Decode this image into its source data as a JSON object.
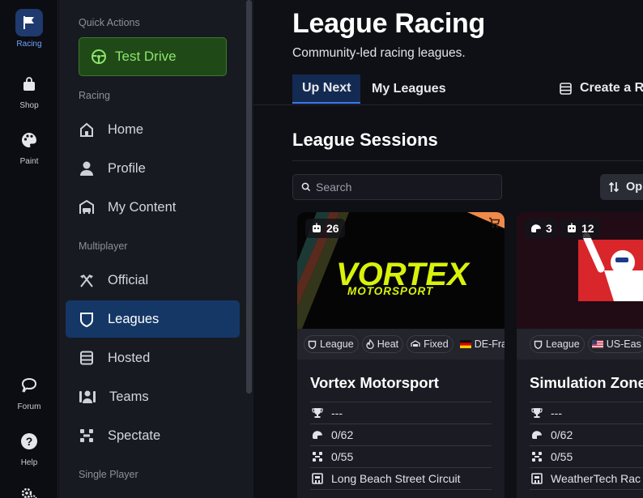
{
  "rail": {
    "items": [
      {
        "label": "Racing",
        "icon": "flag-icon",
        "active": true
      },
      {
        "label": "Shop",
        "icon": "shopping-bag-icon",
        "active": false
      },
      {
        "label": "Paint",
        "icon": "palette-icon",
        "active": false
      },
      {
        "label": "Forum",
        "icon": "chat-bubble-icon",
        "active": false
      },
      {
        "label": "Help",
        "icon": "question-icon",
        "active": false
      },
      {
        "label": "",
        "icon": "gears-icon",
        "active": false
      }
    ]
  },
  "sidebar": {
    "quick_actions_heading": "Quick Actions",
    "test_drive_label": "Test Drive",
    "racing_heading": "Racing",
    "racing_items": [
      {
        "label": "Home",
        "icon": "home-icon"
      },
      {
        "label": "Profile",
        "icon": "person-icon"
      },
      {
        "label": "My Content",
        "icon": "garage-icon"
      }
    ],
    "multiplayer_heading": "Multiplayer",
    "multiplayer_items": [
      {
        "label": "Official",
        "icon": "crossed-flags-icon"
      },
      {
        "label": "Leagues",
        "icon": "shield-icon",
        "active": true
      },
      {
        "label": "Hosted",
        "icon": "server-icon"
      },
      {
        "label": "Teams",
        "icon": "team-icon"
      },
      {
        "label": "Spectate",
        "icon": "spectate-icon"
      }
    ],
    "single_player_heading": "Single Player"
  },
  "main": {
    "title": "League Racing",
    "subtitle": "Community-led racing leagues.",
    "tabs": [
      {
        "label": "Up Next",
        "active": true
      },
      {
        "label": "My Leagues",
        "active": false
      }
    ],
    "create_label": "Create a R",
    "section_title": "League Sessions",
    "search_placeholder": "Search",
    "options_label": "Op"
  },
  "cards": [
    {
      "logo_top": "VORTEX",
      "logo_bottom": "MOTORSPORT",
      "badges": [
        {
          "icon": "robot-icon",
          "value": "26"
        }
      ],
      "cart_icon": "cart-icon",
      "tags": [
        {
          "icon": "shield-icon",
          "label": "League"
        },
        {
          "icon": "flame-icon",
          "label": "Heat"
        },
        {
          "icon": "car-icon",
          "label": "Fixed"
        },
        {
          "icon": "flag-de-icon",
          "label": "DE-Fra"
        }
      ],
      "title": "Vortex Motorsport",
      "rows": [
        {
          "icon": "trophy-icon",
          "value": "---"
        },
        {
          "icon": "helmet-icon",
          "value": "0/62"
        },
        {
          "icon": "cars-icon",
          "value": "0/55"
        },
        {
          "icon": "track-icon",
          "value": "Long Beach Street Circuit"
        }
      ]
    },
    {
      "badges": [
        {
          "icon": "helmet-icon",
          "value": "3"
        },
        {
          "icon": "robot-icon",
          "value": "12"
        }
      ],
      "tags": [
        {
          "icon": "shield-icon",
          "label": "League"
        },
        {
          "icon": "flag-us-icon",
          "label": "US-Eas"
        }
      ],
      "title": "Simulation Zone",
      "rows": [
        {
          "icon": "trophy-icon",
          "value": "---"
        },
        {
          "icon": "helmet-icon",
          "value": "0/62"
        },
        {
          "icon": "cars-icon",
          "value": "0/55"
        },
        {
          "icon": "track-icon",
          "value": "WeatherTech Rac"
        }
      ]
    }
  ],
  "colors": {
    "accent": "#3c7bea",
    "active_nav": "#143766",
    "test_drive_bg": "#1f4a18",
    "test_drive_text": "#8fe36b",
    "vortex_yellow": "#d8f20a",
    "card_corner": "#f08a4b"
  }
}
